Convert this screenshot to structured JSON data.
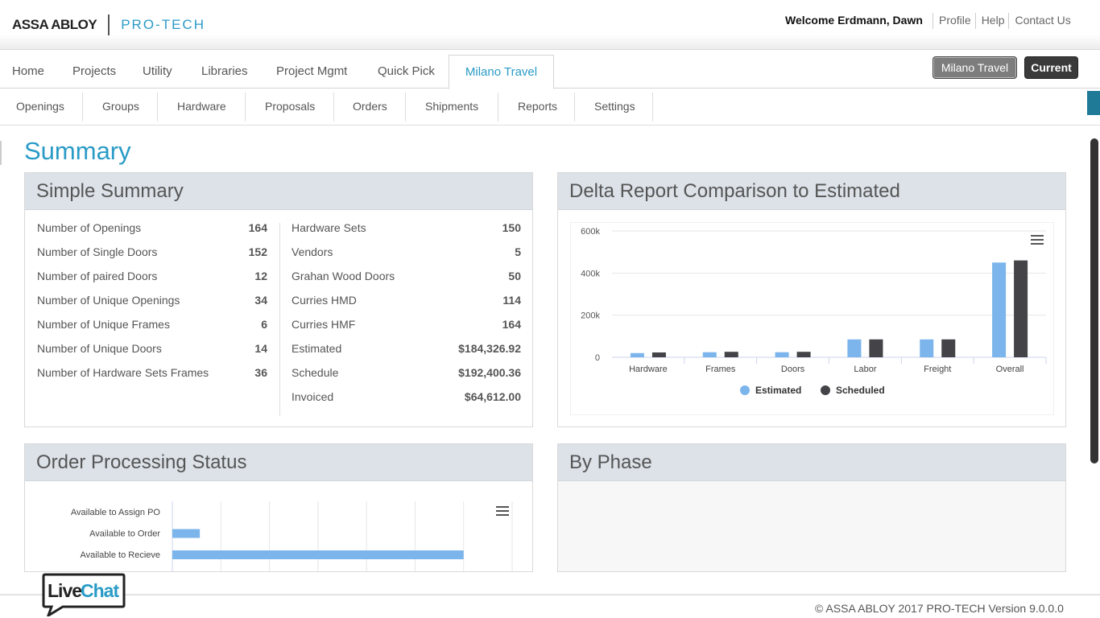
{
  "header": {
    "brand_left": "ASSA ABLOY",
    "brand_right": "PRO-TECH",
    "welcome": "Welcome Erdmann, Dawn",
    "links": [
      "Profile",
      "Help",
      "Contact Us"
    ]
  },
  "mainnav": {
    "items": [
      "Home",
      "Projects",
      "Utility",
      "Libraries",
      "Project Mgmt",
      "Quick Pick"
    ],
    "active": "Milano Travel",
    "project_button": "Milano Travel",
    "current_button": "Current"
  },
  "subnav": {
    "items": [
      "Openings",
      "Groups",
      "Hardware",
      "Proposals",
      "Orders",
      "Shipments",
      "Reports",
      "Settings"
    ]
  },
  "page": {
    "title": "Summary"
  },
  "simple_summary": {
    "title": "Simple Summary",
    "left": [
      {
        "label": "Number of Openings",
        "value": "164"
      },
      {
        "label": "Number of Single Doors",
        "value": "152"
      },
      {
        "label": "Number of paired Doors",
        "value": "12"
      },
      {
        "label": "Number of Unique Openings",
        "value": "34"
      },
      {
        "label": "Number of Unique Frames",
        "value": "6"
      },
      {
        "label": "Number of Unique Doors",
        "value": "14"
      },
      {
        "label": "Number of Hardware Sets Frames",
        "value": "36"
      }
    ],
    "right": [
      {
        "label": "Hardware Sets",
        "value": "150"
      },
      {
        "label": "Vendors",
        "value": "5"
      },
      {
        "label": "Grahan Wood Doors",
        "value": "50"
      },
      {
        "label": "Curries HMD",
        "value": "114"
      },
      {
        "label": "Curries HMF",
        "value": "164"
      },
      {
        "label": "Estimated",
        "value": "$184,326.92"
      },
      {
        "label": "Schedule",
        "value": "$192,400.36"
      },
      {
        "label": "Invoiced",
        "value": "$64,612.00"
      }
    ]
  },
  "delta_panel": {
    "title": "Delta Report Comparison to Estimated"
  },
  "order_panel": {
    "title": "Order Processing Status"
  },
  "phase_panel": {
    "title": "By Phase"
  },
  "colors": {
    "estimated": "#7cb5ec",
    "scheduled": "#434348",
    "accent": "#2a9bc6"
  },
  "chart_data": [
    {
      "type": "bar",
      "categories": [
        "Hardware",
        "Frames",
        "Doors",
        "Labor",
        "Freight",
        "Overall"
      ],
      "series": [
        {
          "name": "Estimated",
          "values": [
            20000,
            24000,
            24000,
            85000,
            85000,
            450000
          ]
        },
        {
          "name": "Scheduled",
          "values": [
            23000,
            26000,
            26000,
            85000,
            85000,
            460000
          ]
        }
      ],
      "yticks": [
        "0",
        "200k",
        "400k",
        "600k"
      ],
      "ylim": [
        0,
        600000
      ],
      "legend": "bottom-center"
    },
    {
      "type": "bar",
      "orientation": "horizontal",
      "categories": [
        "Available to Assign PO",
        "Available to Order",
        "Available to Recieve"
      ],
      "values": [
        0,
        17,
        180
      ],
      "xlim": [
        0,
        210
      ]
    }
  ],
  "footer": {
    "copyright": "© ASSA ABLOY 2017 PRO-TECH Version 9.0.0.0",
    "livechat_live": "Live",
    "livechat_chat": "Chat"
  }
}
